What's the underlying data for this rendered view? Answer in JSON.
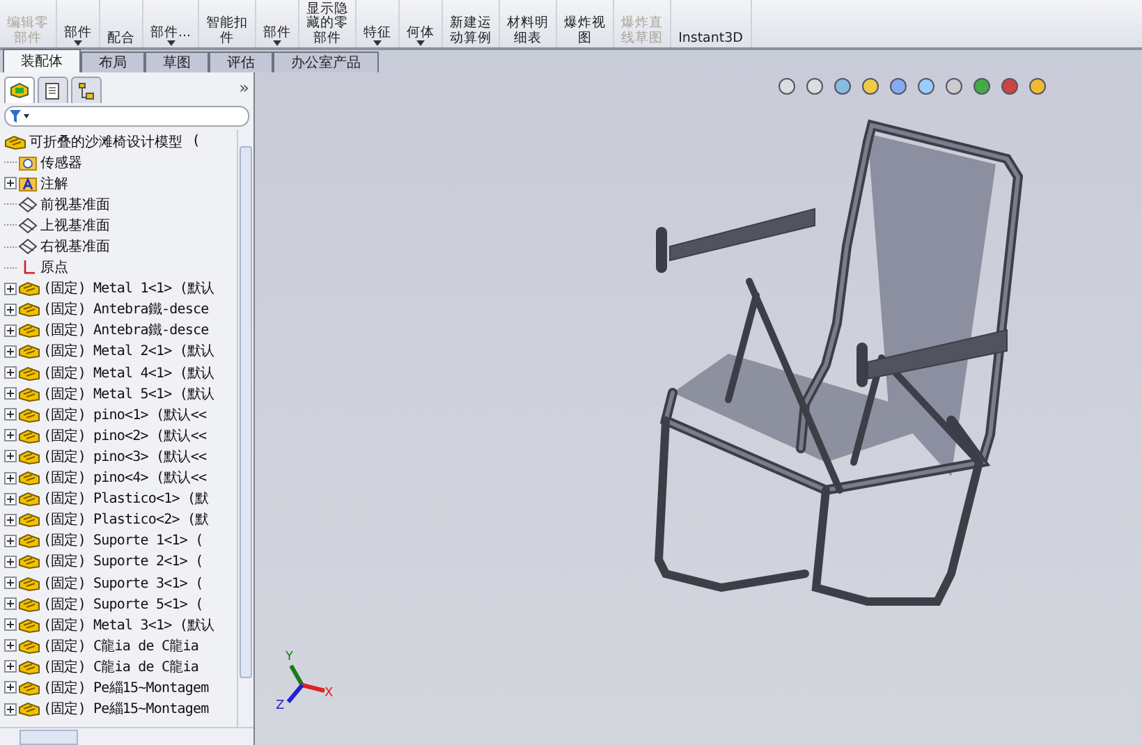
{
  "ribbon": [
    {
      "lines": [
        "编辑零",
        "部件"
      ],
      "disabled": true,
      "dropdown": false
    },
    {
      "lines": [
        "部件"
      ],
      "disabled": false,
      "dropdown": true
    },
    {
      "lines": [
        "配合"
      ],
      "disabled": false,
      "dropdown": false
    },
    {
      "lines": [
        "部件..."
      ],
      "disabled": false,
      "dropdown": true
    },
    {
      "lines": [
        "智能扣",
        "件"
      ],
      "disabled": false,
      "dropdown": false
    },
    {
      "lines": [
        "部件"
      ],
      "disabled": false,
      "dropdown": true
    },
    {
      "lines": [
        "显示隐",
        "藏的零",
        "部件"
      ],
      "disabled": false,
      "dropdown": false
    },
    {
      "lines": [
        "特征"
      ],
      "disabled": false,
      "dropdown": true
    },
    {
      "lines": [
        "何体"
      ],
      "disabled": false,
      "dropdown": true
    },
    {
      "lines": [
        "新建运",
        "动算例"
      ],
      "disabled": false,
      "dropdown": false
    },
    {
      "lines": [
        "材料明",
        "细表"
      ],
      "disabled": false,
      "dropdown": false
    },
    {
      "lines": [
        "爆炸视",
        "图"
      ],
      "disabled": false,
      "dropdown": false
    },
    {
      "lines": [
        "爆炸直",
        "线草图"
      ],
      "disabled": true,
      "dropdown": false
    },
    {
      "lines": [
        "Instant3D"
      ],
      "disabled": false,
      "dropdown": false
    }
  ],
  "tabs": [
    {
      "label": "装配体",
      "selected": true
    },
    {
      "label": "布局",
      "selected": false
    },
    {
      "label": "草图",
      "selected": false
    },
    {
      "label": "评估",
      "selected": false
    },
    {
      "label": "办公室产品",
      "selected": false
    }
  ],
  "panel_tabs": [
    {
      "kind": "tree",
      "selected": true
    },
    {
      "kind": "property",
      "selected": false
    },
    {
      "kind": "config",
      "selected": false
    }
  ],
  "panel_more": "»",
  "tree": {
    "root": "可折叠的沙滩椅设计模型",
    "root_suffix": "(",
    "items": [
      {
        "kind": "sensor",
        "label": "传感器",
        "expandable": false
      },
      {
        "kind": "annotation",
        "label": "注解",
        "expandable": true
      },
      {
        "kind": "plane",
        "label": "前视基准面",
        "expandable": false
      },
      {
        "kind": "plane",
        "label": "上视基准面",
        "expandable": false
      },
      {
        "kind": "plane",
        "label": "右视基准面",
        "expandable": false
      },
      {
        "kind": "origin",
        "label": "原点",
        "expandable": false
      },
      {
        "kind": "part",
        "label": "(固定) Metal 1<1> (默认",
        "expandable": true
      },
      {
        "kind": "part",
        "label": "(固定) Antebra鐵-desce",
        "expandable": true
      },
      {
        "kind": "part",
        "label": "(固定) Antebra鐵-desce",
        "expandable": true
      },
      {
        "kind": "part",
        "label": "(固定) Metal 2<1> (默认",
        "expandable": true
      },
      {
        "kind": "part",
        "label": "(固定) Metal 4<1> (默认",
        "expandable": true
      },
      {
        "kind": "part",
        "label": "(固定) Metal 5<1> (默认",
        "expandable": true
      },
      {
        "kind": "part",
        "label": "(固定) pino<1> (默认<<",
        "expandable": true
      },
      {
        "kind": "part",
        "label": "(固定) pino<2> (默认<<",
        "expandable": true
      },
      {
        "kind": "part",
        "label": "(固定) pino<3> (默认<<",
        "expandable": true
      },
      {
        "kind": "part",
        "label": "(固定) pino<4> (默认<<",
        "expandable": true
      },
      {
        "kind": "part",
        "label": "(固定) Plastico<1> (默",
        "expandable": true
      },
      {
        "kind": "part",
        "label": "(固定) Plastico<2> (默",
        "expandable": true
      },
      {
        "kind": "part",
        "label": "(固定) Suporte 1<1> (",
        "expandable": true
      },
      {
        "kind": "part",
        "label": "(固定) Suporte 2<1> (",
        "expandable": true
      },
      {
        "kind": "part",
        "label": "(固定) Suporte 3<1> (",
        "expandable": true
      },
      {
        "kind": "part",
        "label": "(固定) Suporte 5<1> (",
        "expandable": true
      },
      {
        "kind": "part",
        "label": "(固定) Metal 3<1> (默认",
        "expandable": true
      },
      {
        "kind": "part",
        "label": "(固定) C龍ia de C龍ia",
        "expandable": true
      },
      {
        "kind": "part",
        "label": "(固定) C龍ia de C龍ia",
        "expandable": true
      },
      {
        "kind": "part",
        "label": "(固定) Pe緇15~Montagem",
        "expandable": true
      },
      {
        "kind": "part",
        "label": "(固定) Pe緇15~Montagem",
        "expandable": true
      }
    ]
  },
  "triad": {
    "x": "X",
    "y": "Y",
    "z": "Z"
  }
}
